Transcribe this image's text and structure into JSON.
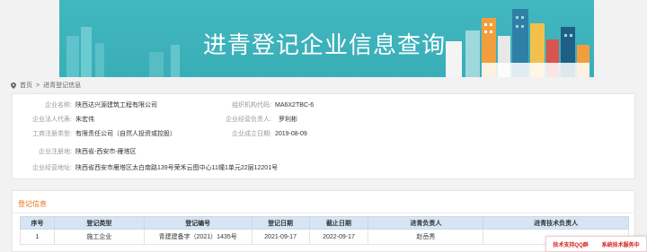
{
  "banner": {
    "title": "进青登记企业信息查询"
  },
  "breadcrumb": {
    "home": "首页",
    "separator": ">",
    "current": "进青登记信息"
  },
  "company": {
    "name_label": "企业名称:",
    "name": "陕西达兴源建筑工程有限公司",
    "org_code_label": "组织机构代码:",
    "org_code": "MA6X2TBC-6",
    "legal_rep_label": "企业法人代表:",
    "legal_rep": "朱宏伟",
    "manager_label": "企业经营负责人:",
    "manager": "罗利彬",
    "reg_type_label": "工商注册类型:",
    "reg_type": "有限责任公司（自然人投资或控股）",
    "founded_label": "企业成立日期:",
    "founded": "2019-08-09",
    "location_label": "企业注册地:",
    "location": "陕西省-西安市-雁塔区",
    "address_label": "企业经营地址:",
    "address": "陕西省西安市雁塔区太白南路139号荣禾云图中心11幢1单元22层12201号"
  },
  "registration": {
    "section_title": "登记信息",
    "columns": [
      "序号",
      "登记类型",
      "登记编号",
      "登记日期",
      "截止日期",
      "进青负责人",
      "进青技术负责人"
    ],
    "rows": [
      [
        "1",
        "施工企业",
        "青建建备字（2021）1435号",
        "2021-09-17",
        "2022-09-17",
        "赵岳秀",
        ""
      ]
    ]
  },
  "float_buttons": {
    "support": "技术支持QQ群",
    "service": "系统技术服务中"
  },
  "colors": {
    "banner": "#3eb3bc",
    "accent": "#e8731d",
    "table_header": "#d6e4f3",
    "float_text": "#d42020"
  }
}
